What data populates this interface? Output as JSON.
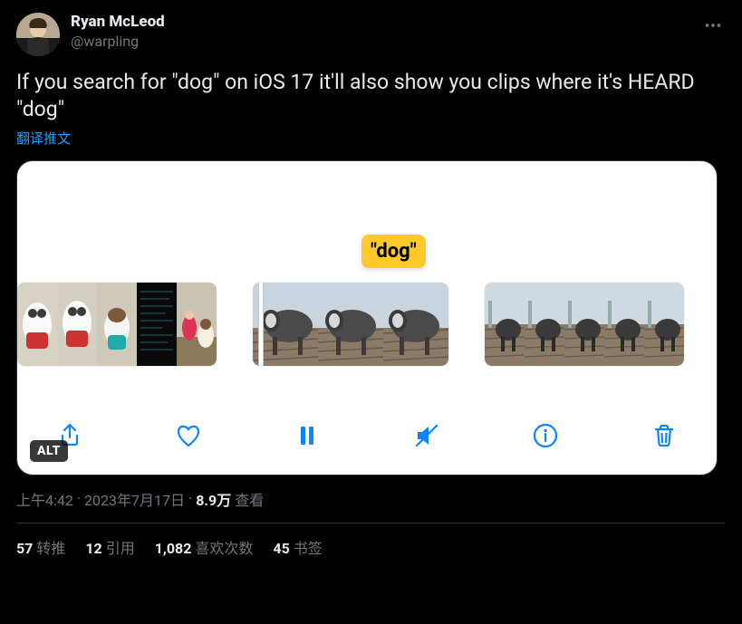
{
  "author": {
    "display_name": "Ryan McLeod",
    "handle": "@warpling"
  },
  "tweet_text": "If you search for \"dog\" on iOS 17 it'll also show you clips where it's HEARD \"dog\"",
  "translate_label": "翻译推文",
  "media": {
    "search_pill": "\"dog\"",
    "alt_badge": "ALT",
    "toolbar_icons": {
      "share": "share-icon",
      "like": "heart-icon",
      "pause": "pause-icon",
      "mute": "mute-icon",
      "info": "info-icon",
      "delete": "trash-icon"
    }
  },
  "meta": {
    "time": "上午4:42",
    "dot1": "·",
    "date": "2023年7月17日",
    "dot2": "·",
    "views_count": "8.9万",
    "views_label": "查看"
  },
  "stats": {
    "retweets": {
      "count": "57",
      "label": "转推"
    },
    "quotes": {
      "count": "12",
      "label": "引用"
    },
    "likes": {
      "count": "1,082",
      "label": "喜欢次数"
    },
    "bookmarks": {
      "count": "45",
      "label": "书签"
    }
  }
}
